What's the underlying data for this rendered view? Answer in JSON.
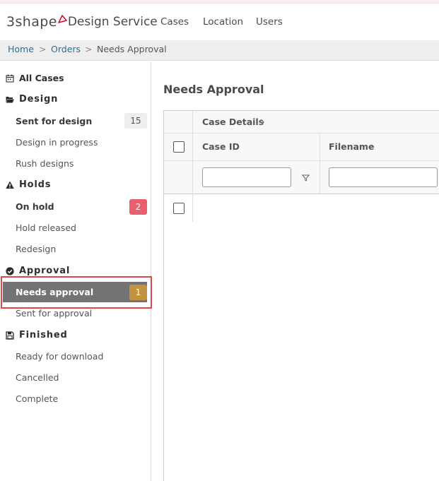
{
  "app": {
    "brand": "3shape",
    "product": "Design Service",
    "accent_color": "#c8102e"
  },
  "nav": {
    "items": [
      "Cases",
      "Location",
      "Users"
    ]
  },
  "breadcrumb": {
    "items": [
      "Home",
      "Orders",
      "Needs Approval"
    ],
    "separator": ">"
  },
  "sidebar": {
    "all_cases": {
      "label": "All Cases",
      "icon": "calendar-icon"
    },
    "groups": [
      {
        "title": "Design",
        "icon": "folder-open-icon",
        "items": [
          {
            "label": "Sent for design",
            "count": "15",
            "bold": true
          },
          {
            "label": "Design in progress"
          },
          {
            "label": "Rush designs"
          }
        ]
      },
      {
        "title": "Holds",
        "icon": "warning-icon",
        "items": [
          {
            "label": "On hold",
            "count": "2",
            "bold": true,
            "badge_color": "#e8606d"
          },
          {
            "label": "Hold released"
          },
          {
            "label": "Redesign"
          }
        ]
      },
      {
        "title": "Approval",
        "icon": "check-circle-icon",
        "items": [
          {
            "label": "Needs approval",
            "count": "1",
            "bold": true,
            "active": true,
            "badge_color": "#c4933f"
          },
          {
            "label": "Sent for approval"
          }
        ]
      },
      {
        "title": "Finished",
        "icon": "save-icon",
        "items": [
          {
            "label": "Ready for download"
          },
          {
            "label": "Cancelled"
          },
          {
            "label": "Complete"
          }
        ]
      }
    ]
  },
  "main": {
    "title": "Needs Approval",
    "grid": {
      "group_header": "Case Details",
      "columns": [
        "Case ID",
        "Filename"
      ],
      "filters": {
        "case_id": "",
        "filename": ""
      }
    }
  }
}
